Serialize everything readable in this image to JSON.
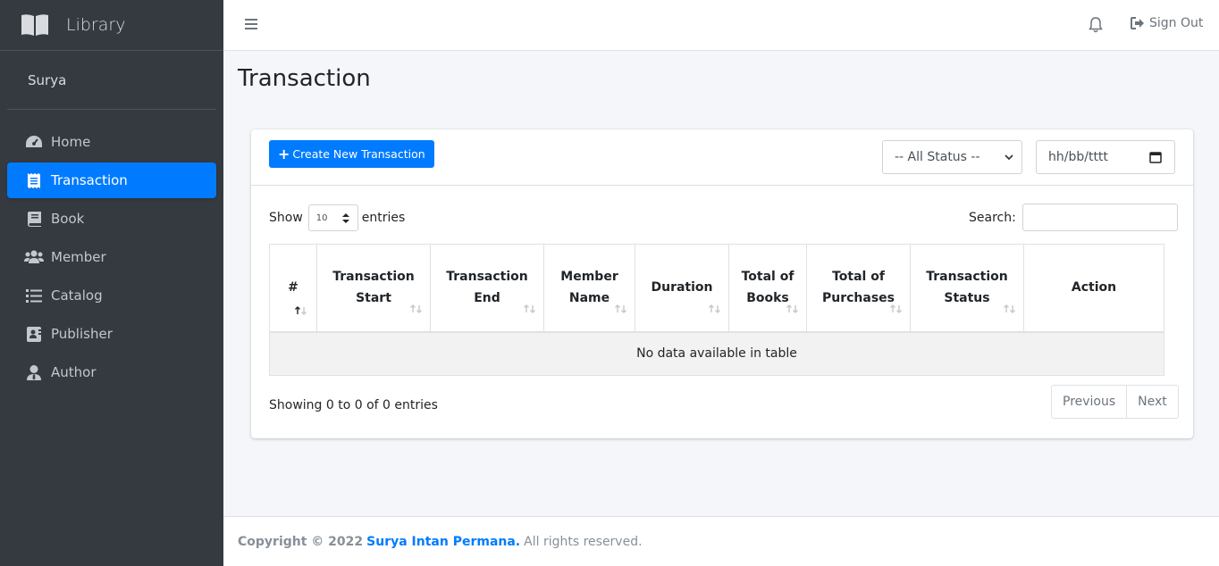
{
  "brand": {
    "name": "Library"
  },
  "user": {
    "name": "Surya"
  },
  "sidebar": {
    "items": [
      {
        "label": "Home",
        "icon": "tachometer-icon"
      },
      {
        "label": "Transaction",
        "icon": "receipt-icon",
        "active": true
      },
      {
        "label": "Book",
        "icon": "book-icon"
      },
      {
        "label": "Member",
        "icon": "users-icon"
      },
      {
        "label": "Catalog",
        "icon": "list-icon"
      },
      {
        "label": "Publisher",
        "icon": "address-card-icon"
      },
      {
        "label": "Author",
        "icon": "user-tie-icon"
      }
    ]
  },
  "topbar": {
    "signout_label": "Sign Out"
  },
  "page": {
    "title": "Transaction"
  },
  "toolbar": {
    "create_label": "Create New Transaction",
    "status_selected": "-- All Status --",
    "date_placeholder": "hh/bb/tttt"
  },
  "table_controls": {
    "show_label": "Show",
    "entries_value": "10",
    "entries_label": "entries",
    "search_label": "Search:"
  },
  "table": {
    "headers": [
      "#",
      "Transaction Start",
      "Transaction End",
      "Member Name",
      "Duration",
      "Total of Books",
      "Total of Purchases",
      "Transaction Status",
      "Action"
    ],
    "empty_message": "No data available in table"
  },
  "pagination": {
    "info": "Showing 0 to 0 of 0 entries",
    "previous": "Previous",
    "next": "Next"
  },
  "footer": {
    "prefix": "Copyright © 2022",
    "author": "Surya Intan Permana.",
    "suffix": "All rights reserved."
  },
  "colors": {
    "primary": "#007bff",
    "sidebar": "#343a40"
  }
}
